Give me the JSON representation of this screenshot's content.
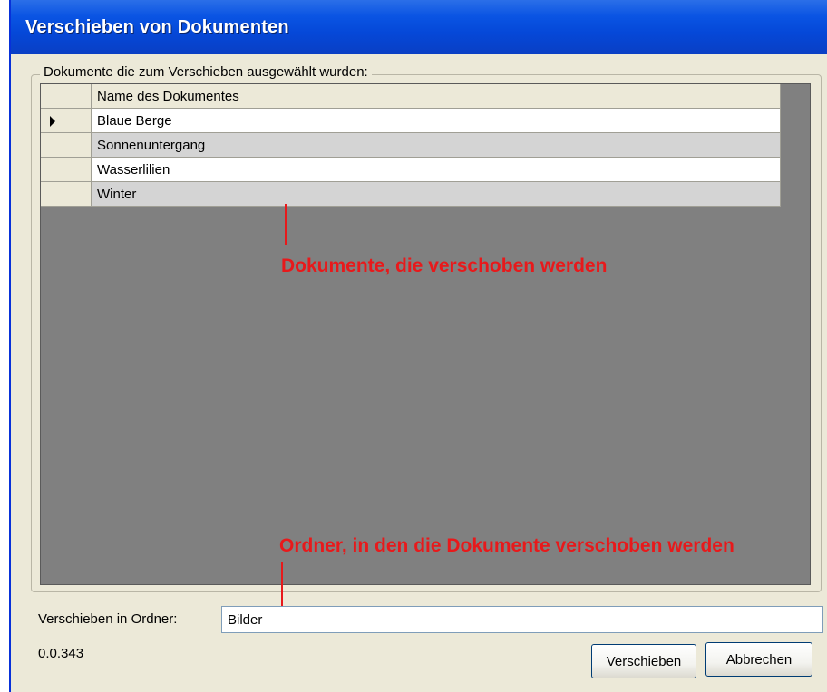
{
  "window": {
    "title": "Verschieben von Dokumenten"
  },
  "group": {
    "legend": "Dokumente die zum Verschieben ausgewählt wurden:"
  },
  "grid": {
    "header": "Name des Dokumentes",
    "rows": [
      {
        "name": "Blaue Berge",
        "selected": true
      },
      {
        "name": "Sonnenuntergang",
        "selected": false
      },
      {
        "name": "Wasserlilien",
        "selected": false
      },
      {
        "name": "Winter",
        "selected": false
      }
    ]
  },
  "annotations": {
    "documents": "Dokumente, die verschoben werden",
    "folder": "Ordner, in den die Dokumente verschoben werden"
  },
  "folder": {
    "label": "Verschieben in Ordner:",
    "value": "Bilder"
  },
  "version": "0.0.343",
  "buttons": {
    "move": "Verschieben",
    "cancel": "Abbrechen"
  },
  "colors": {
    "annotation": "#e8191b",
    "titlebar": "#0548d8",
    "grid_background": "#808080"
  }
}
